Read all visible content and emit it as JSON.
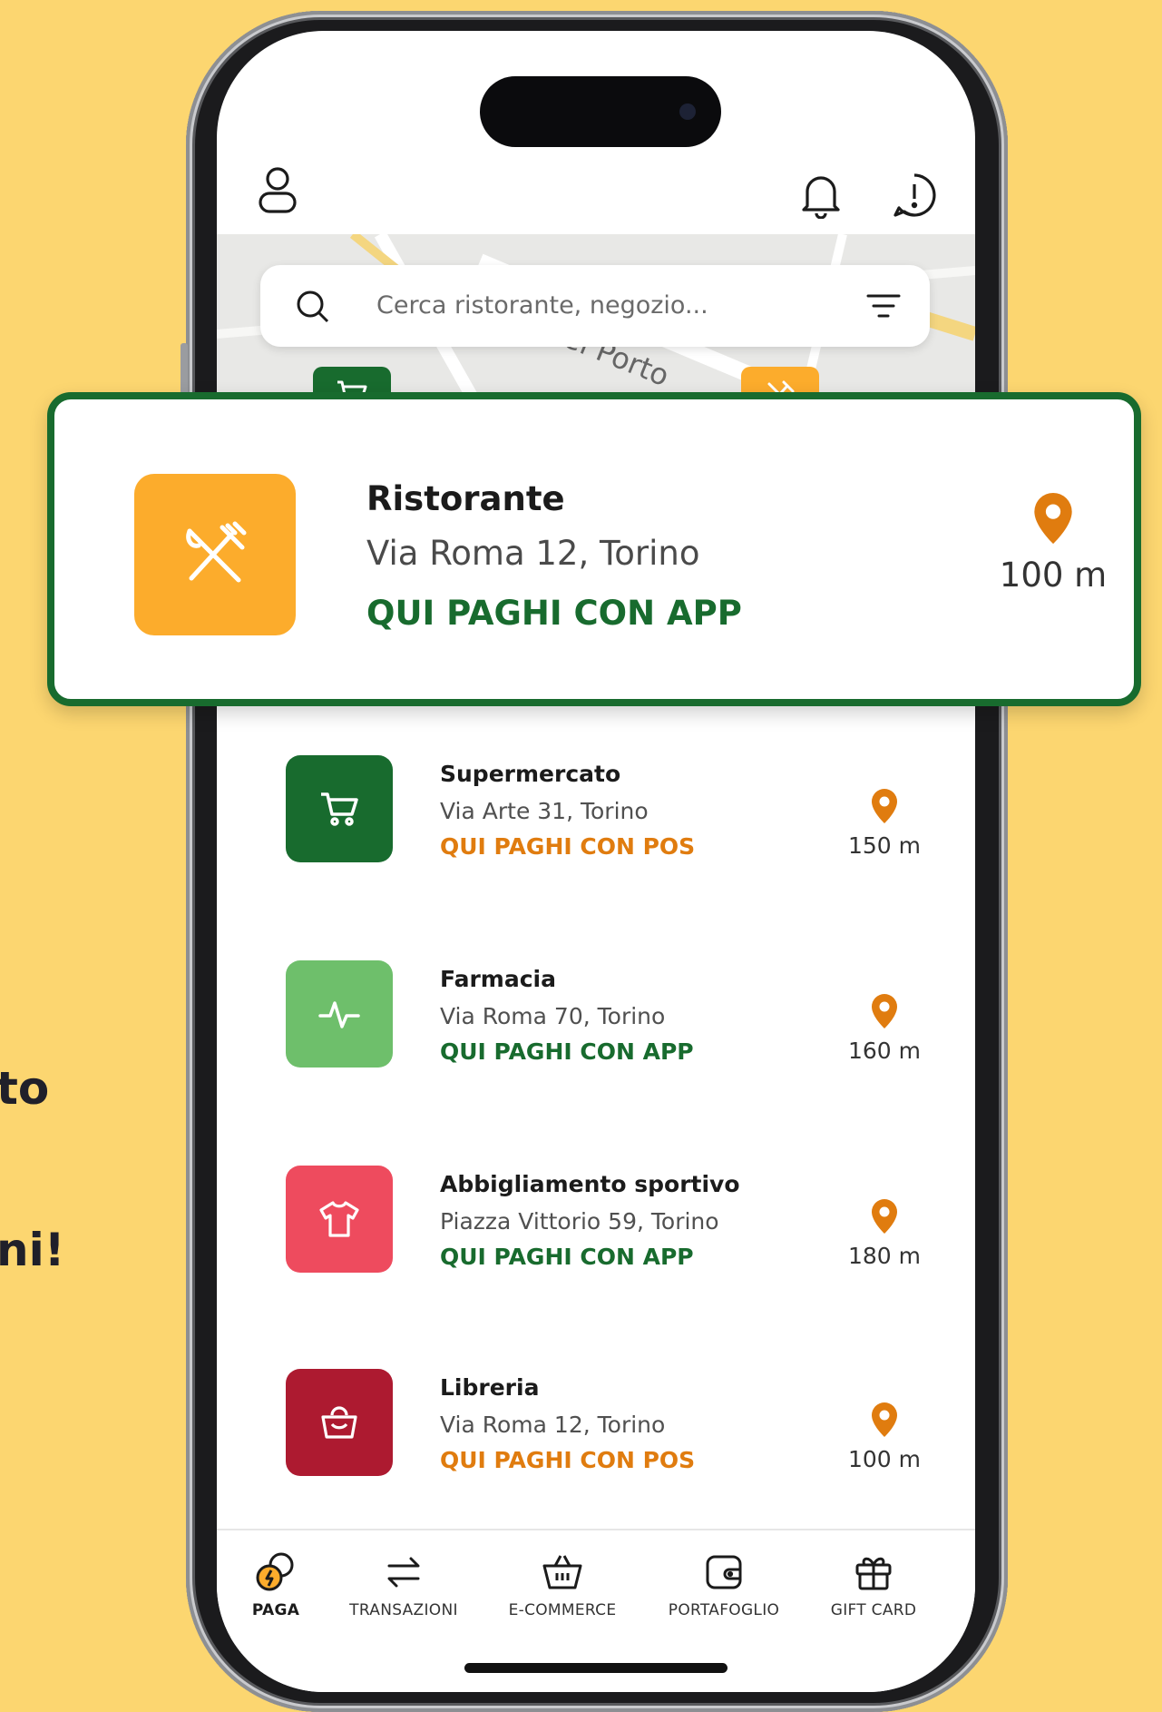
{
  "background_text": {
    "line1": "to",
    "line2": "ni!"
  },
  "colors": {
    "background": "#fcd670",
    "brand_green": "#186b2e",
    "orange": "#e07c0f",
    "restaurant_orange": "#fcac2c",
    "pharmacy_green": "#6ebf6b",
    "sport_red": "#ee4b5e",
    "library_red": "#ad1a30"
  },
  "header": {
    "profile_icon": "user-icon",
    "notifications_icon": "bell-icon",
    "info_icon": "alert-circle-icon"
  },
  "search": {
    "placeholder": "Cerca ristorante, negozio...",
    "icon": "search-icon",
    "filter_icon": "filter-icon"
  },
  "map": {
    "street_label": "del Porto"
  },
  "featured": {
    "name": "Ristorante",
    "address": "Via Roma 12, Torino",
    "payment": "QUI PAGHI CON APP",
    "distance": "100 m",
    "icon": "fork-knife-icon"
  },
  "stores": [
    {
      "name": "Supermercato",
      "address": "Via Arte 31, Torino",
      "payment": "QUI PAGHI CON POS",
      "distance": "150 m",
      "icon": "cart-icon"
    },
    {
      "name": "Farmacia",
      "address": "Via Roma 70, Torino",
      "payment": "QUI PAGHI CON APP",
      "distance": "160 m",
      "icon": "pulse-icon"
    },
    {
      "name": "Abbigliamento sportivo",
      "address": "Piazza Vittorio 59, Torino",
      "payment": "QUI PAGHI CON APP",
      "distance": "180 m",
      "icon": "tshirt-icon"
    },
    {
      "name": "Libreria",
      "address": "Via Roma 12, Torino",
      "payment": "QUI PAGHI CON POS",
      "distance": "100 m",
      "icon": "bag-icon"
    }
  ],
  "nav": {
    "items": [
      {
        "label": "PAGA",
        "icon": "coins-icon",
        "active": true
      },
      {
        "label": "TRANSAZIONI",
        "icon": "arrows-exchange-icon",
        "active": false
      },
      {
        "label": "E-COMMERCE",
        "icon": "basket-icon",
        "active": false
      },
      {
        "label": "PORTAFOGLIO",
        "icon": "wallet-icon",
        "active": false
      },
      {
        "label": "GIFT CARD",
        "icon": "gift-icon",
        "active": false
      }
    ]
  }
}
